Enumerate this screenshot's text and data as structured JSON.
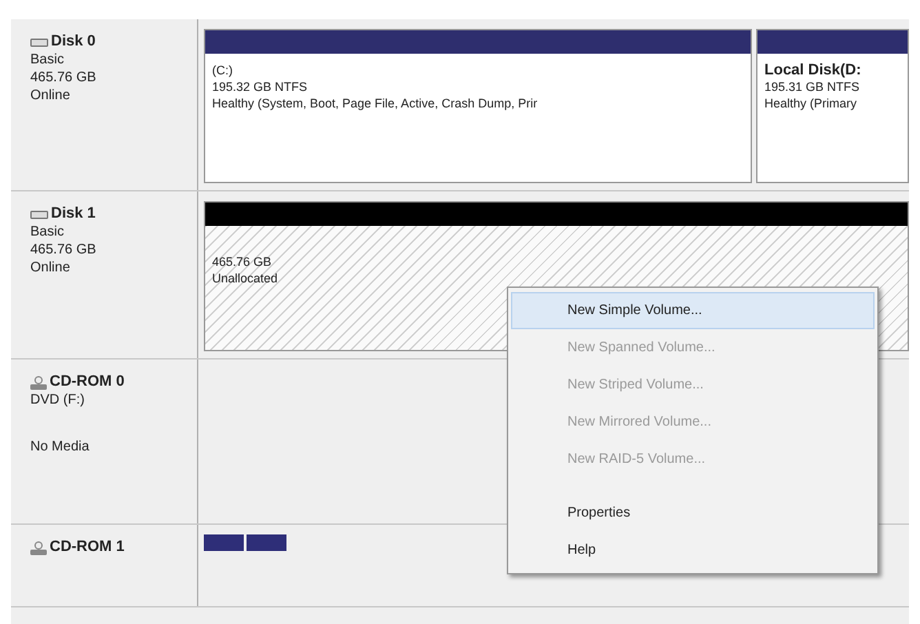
{
  "disks": [
    {
      "kind": "disk",
      "name": "Disk 0",
      "lines": [
        "Basic",
        "465.76 GB",
        "Online"
      ],
      "color": "#2e2e6e",
      "volumes": [
        {
          "kind": "volume",
          "title": "(C:)",
          "size": "195.32 GB NTFS",
          "status": "Healthy (System, Boot, Page File, Active, Crash Dump, Prir"
        },
        {
          "kind": "volume",
          "title": "Local Disk(D:",
          "size": "195.31 GB NTFS",
          "status": "Healthy (Primary"
        }
      ]
    },
    {
      "kind": "disk",
      "name": "Disk 1",
      "lines": [
        "Basic",
        "465.76 GB",
        "Online"
      ],
      "color": "#000000",
      "volumes": [
        {
          "kind": "unallocated",
          "size": "465.76 GB",
          "status": "Unallocated"
        }
      ]
    },
    {
      "kind": "cdrom",
      "name": "CD-ROM 0",
      "lines": [
        "DVD (F:)"
      ],
      "media": "No Media"
    },
    {
      "kind": "cdrom",
      "name": "CD-ROM 1",
      "volumes": [
        {
          "kind": "stub"
        }
      ]
    }
  ],
  "context_menu": [
    {
      "label": "New Simple Volume...",
      "selected": true,
      "disabled": false
    },
    {
      "label": "New Spanned Volume...",
      "selected": false,
      "disabled": true
    },
    {
      "label": "New Striped Volume...",
      "selected": false,
      "disabled": true
    },
    {
      "label": "New Mirrored Volume...",
      "selected": false,
      "disabled": true
    },
    {
      "label": "New RAID-5 Volume...",
      "selected": false,
      "disabled": true
    },
    {
      "kind": "separator"
    },
    {
      "label": "Properties",
      "selected": false,
      "disabled": false
    },
    {
      "label": "Help",
      "selected": false,
      "disabled": false
    }
  ]
}
